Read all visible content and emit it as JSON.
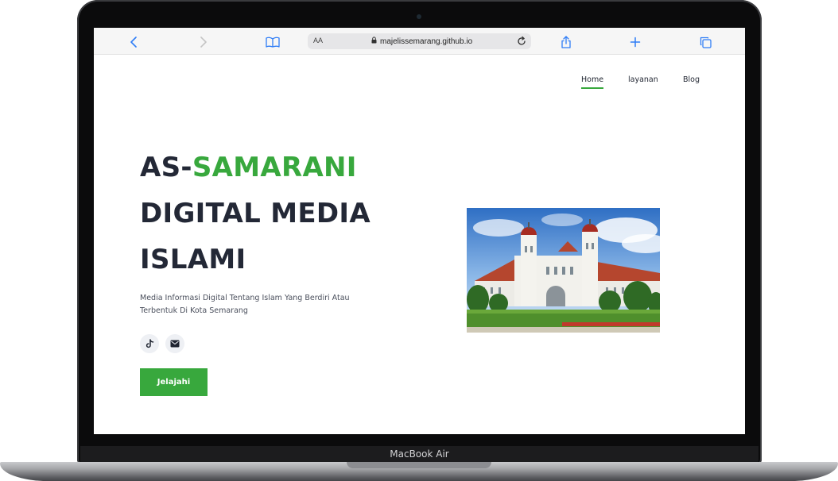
{
  "device": {
    "label": "MacBook Air"
  },
  "browser": {
    "text_size_label": "AA",
    "url": "majelissemarang.github.io",
    "icons": [
      "back-chevron",
      "forward-chevron",
      "book-open",
      "lock",
      "reload",
      "share",
      "plus",
      "tabs"
    ]
  },
  "nav": {
    "items": [
      {
        "label": "Home",
        "active": true
      },
      {
        "label": "layanan",
        "active": false
      },
      {
        "label": "Blog",
        "active": false
      }
    ]
  },
  "hero": {
    "title_prefix": "AS-",
    "title_accent": "SAMARANI",
    "title_line2": "DIGITAL MEDIA",
    "title_line3": "ISLAMI",
    "description": "Media Informasi Digital Tentang Islam Yang Berdiri Atau Terbentuk Di Kota Semarang",
    "socials": [
      "tiktok-icon",
      "mail-icon"
    ],
    "cta_label": "Jelajahi",
    "image_subject": "Lawang Sewu building, Semarang"
  },
  "colors": {
    "accent": "#38a83d",
    "heading": "#232836",
    "link_blue": "#2f7df6"
  }
}
